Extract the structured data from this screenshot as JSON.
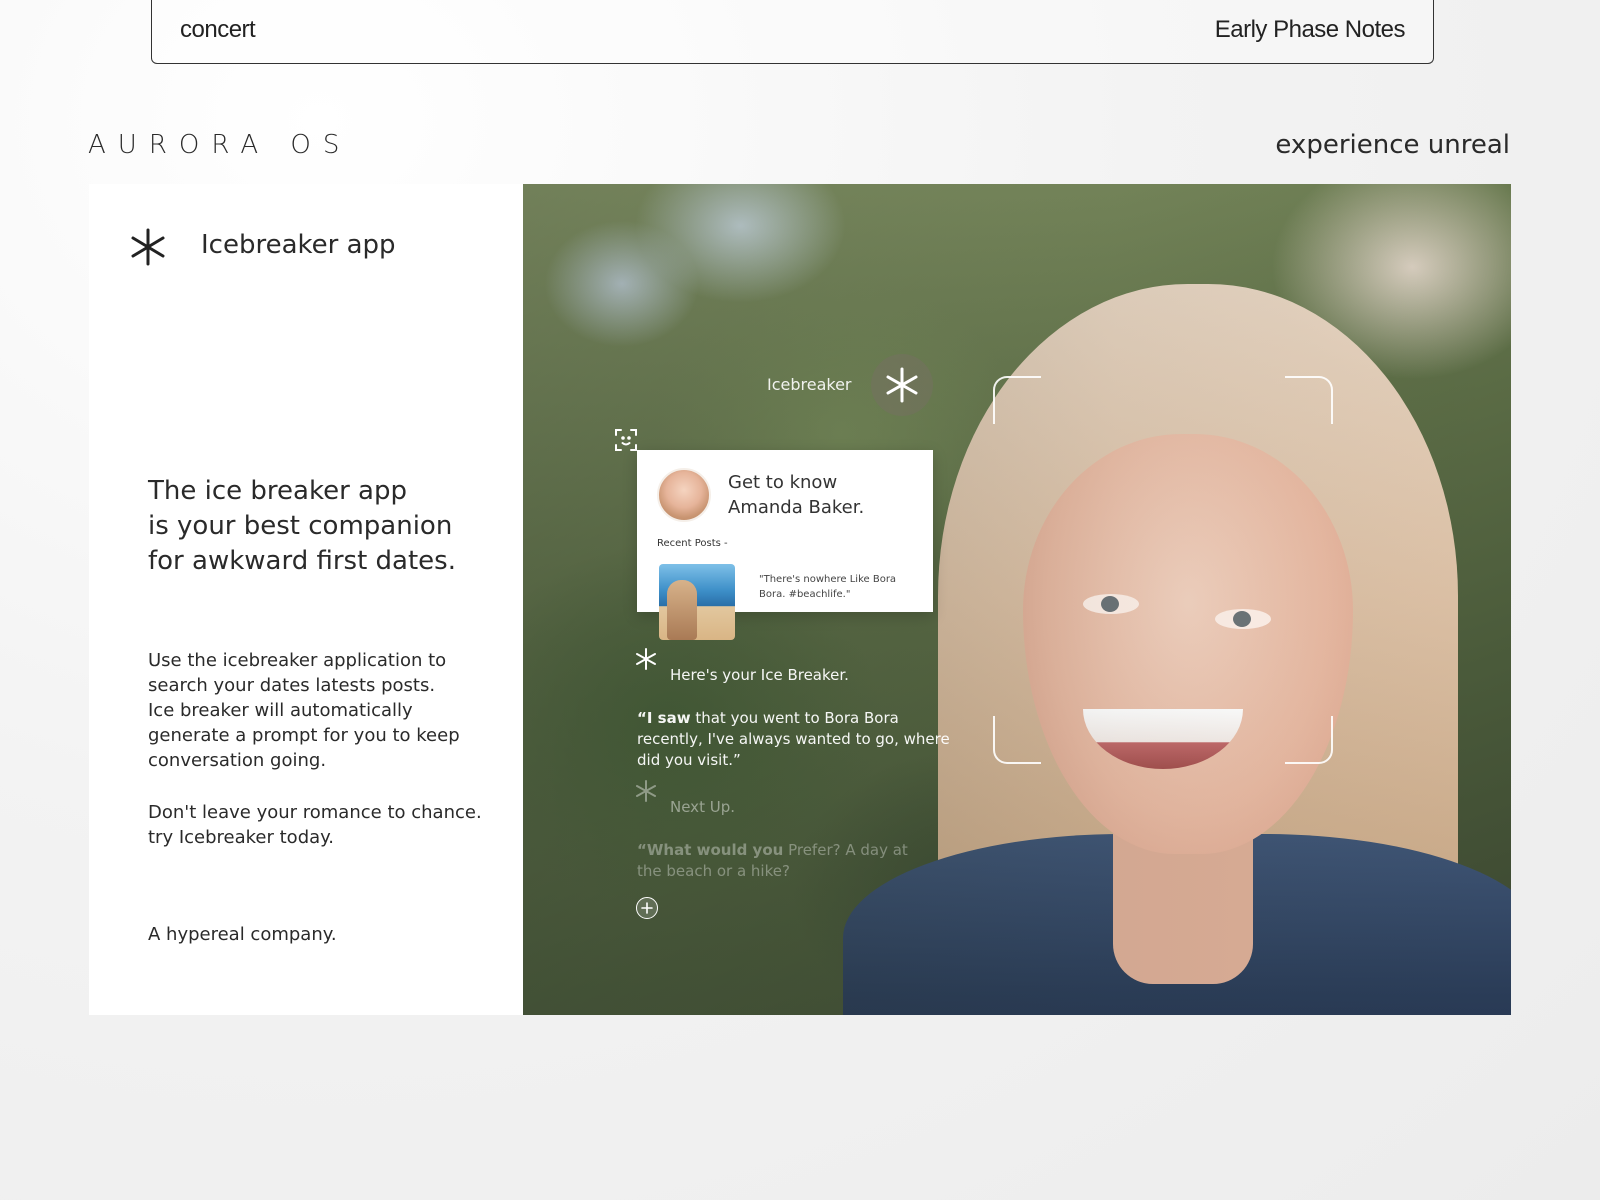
{
  "header": {
    "left_label": "concert",
    "right_label": "Early Phase Notes"
  },
  "brand": {
    "name": "AURORA OS",
    "tagline": "experience unreal"
  },
  "panel": {
    "icon": "asterisk-icon",
    "app_title": "Icebreaker app",
    "headline_1": "The ice breaker app",
    "headline_2": "is your best companion",
    "headline_3": "for awkward first dates.",
    "body_1": "Use the icebreaker application to",
    "body_2": "search your dates latests posts.",
    "body_3": "Ice breaker will automatically",
    "body_4": "generate a prompt for you to keep",
    "body_5": "conversation going.",
    "cta_1": "Don't leave your romance to chance.",
    "cta_2": "try Icebreaker today.",
    "company": "A hypereal company."
  },
  "overlay": {
    "label": "Icebreaker",
    "badge_icon": "asterisk-icon",
    "scan_icon": "face-scan-icon",
    "card": {
      "title_1": "Get to know",
      "title_2": "Amanda Baker.",
      "posts_label": "Recent Posts -",
      "post_quote": "\"There's nowhere Like Bora Bora. #beachlife.\""
    },
    "icebreaker": {
      "heading": "Here's your Ice Breaker.",
      "quote_bold": "“I saw",
      "quote_rest": " that you went to Bora Bora recently, I've always  wanted to go, where did you visit.”"
    },
    "next": {
      "heading": "Next Up.",
      "quote_bold": "“What would you",
      "quote_rest": " Prefer? A day at the beach or a hike?"
    },
    "add_icon": "plus-icon"
  }
}
